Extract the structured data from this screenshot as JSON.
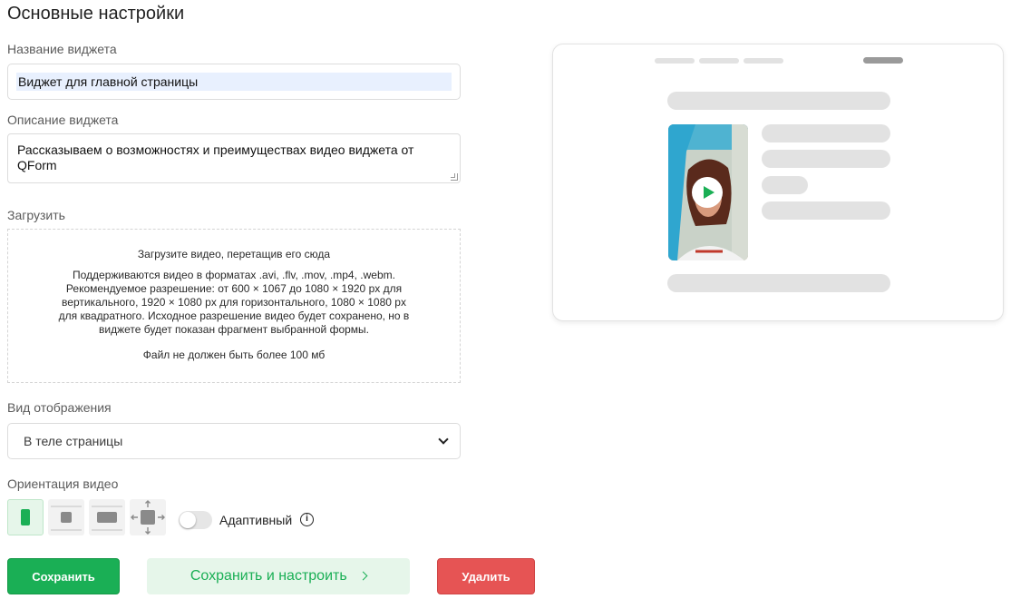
{
  "page_title": "Основные настройки",
  "widget_name": {
    "label": "Название виджета",
    "value": "Виджет для главной страницы"
  },
  "widget_description": {
    "label": "Описание виджета",
    "value": "Рассказываем о возможностях и преимуществах видео виджета от QForm"
  },
  "upload": {
    "label": "Загрузить",
    "hint": "Загрузите видео, перетащив его сюда",
    "formats": "Поддерживаются видео в форматах .avi, .flv, .mov, .mp4, .webm. Рекомендуемое разрешение: от 600 × 1067 до 1080 × 1920 px для вертикального, 1920 × 1080 px для горизонтального, 1080 × 1080 px для квадратного. Исходное разрешение видео будет сохранено, но в виджете будет показан фрагмент выбранной формы.",
    "size_limit": "Файл не должен быть более 100 мб"
  },
  "display_mode": {
    "label": "Вид отображения",
    "selected": "В теле страницы"
  },
  "orientation": {
    "label": "Ориентация видео",
    "options": [
      "vertical-icon",
      "square-icon",
      "horizontal-icon",
      "fullscreen-icon"
    ],
    "selected_index": 0,
    "adaptive_label": "Адаптивный",
    "adaptive_on": false,
    "info_glyph": "i"
  },
  "buttons": {
    "save": "Сохранить",
    "save_and_configure": "Сохранить и настроить",
    "delete": "Удалить"
  },
  "colors": {
    "primary_green": "#1aaf55",
    "light_green": "#e6f6ea",
    "danger_red": "#e65454"
  }
}
